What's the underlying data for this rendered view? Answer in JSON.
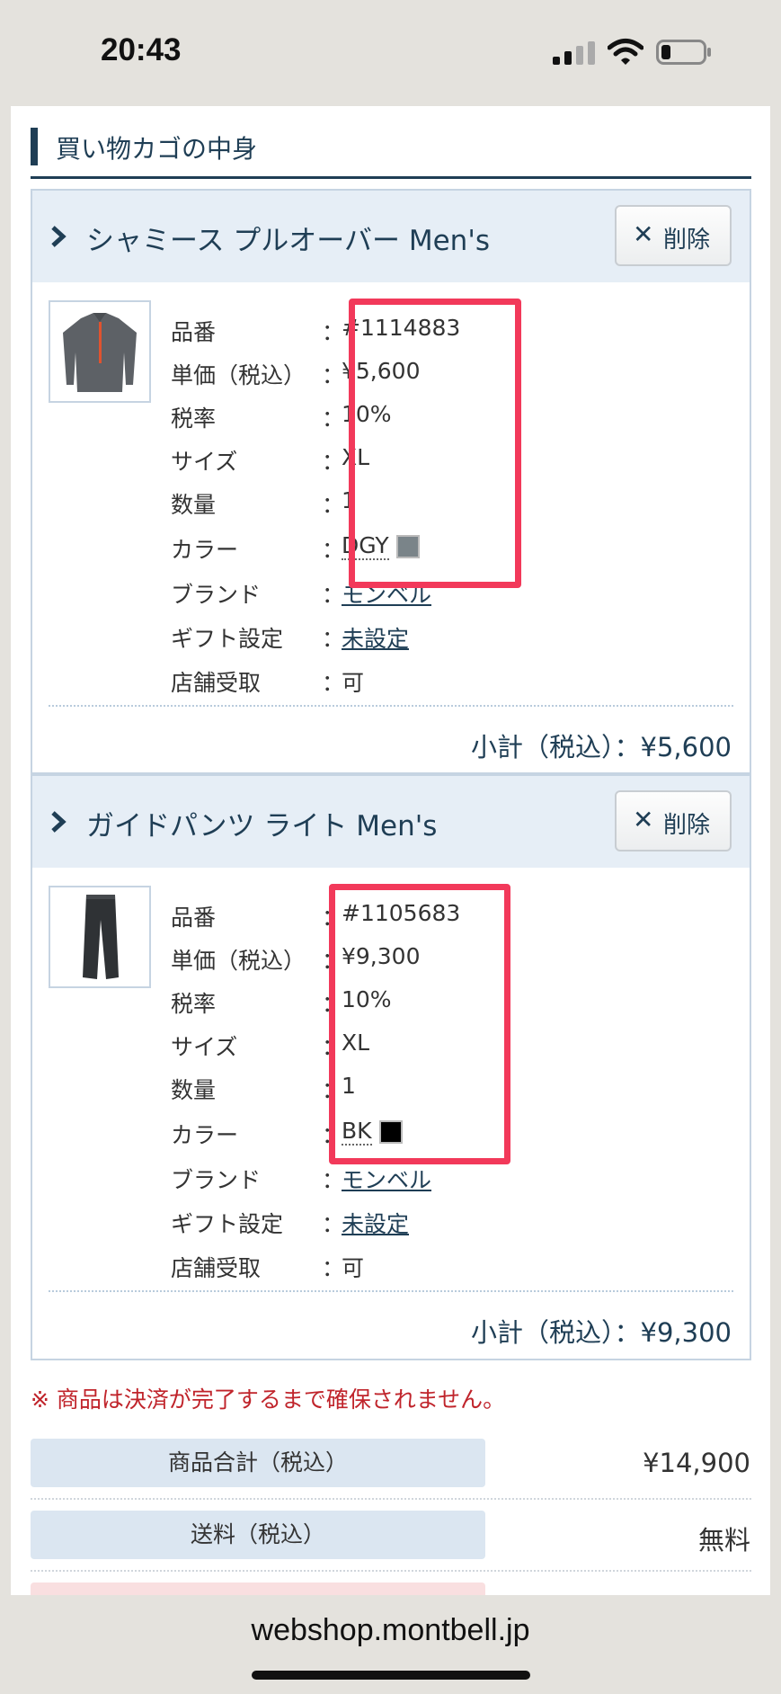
{
  "status_bar": {
    "time": "20:43"
  },
  "section_title": "買い物カゴの中身",
  "labels": {
    "colon": "：",
    "delete": "削除"
  },
  "items": [
    {
      "name": "シャミース プルオーバー Men's",
      "thumbnail": "pullover-jacket-image",
      "fields": {
        "part_no": {
          "label": "品番",
          "value": "#1114883"
        },
        "unit_price": {
          "label": "単価（税込）",
          "value": "¥5,600"
        },
        "tax_rate": {
          "label": "税率",
          "value": "10%"
        },
        "size": {
          "label": "サイズ",
          "value": "XL"
        },
        "quantity": {
          "label": "数量",
          "value": "1"
        },
        "color": {
          "label": "カラー",
          "value": "DGY",
          "swatch": "#7a8489"
        },
        "brand": {
          "label": "ブランド",
          "value": "モンベル"
        },
        "gift": {
          "label": "ギフト設定",
          "value": "未設定"
        },
        "store_pickup": {
          "label": "店舗受取",
          "value": "可"
        }
      },
      "subtotal": "小計（税込）：¥5,600"
    },
    {
      "name": "ガイドパンツ ライト Men's",
      "thumbnail": "pants-image",
      "fields": {
        "part_no": {
          "label": "品番",
          "value": "#1105683"
        },
        "unit_price": {
          "label": "単価（税込）",
          "value": "¥9,300"
        },
        "tax_rate": {
          "label": "税率",
          "value": "10%"
        },
        "size": {
          "label": "サイズ",
          "value": "XL"
        },
        "quantity": {
          "label": "数量",
          "value": "1"
        },
        "color": {
          "label": "カラー",
          "value": "BK",
          "swatch": "#000000"
        },
        "brand": {
          "label": "ブランド",
          "value": "モンベル"
        },
        "gift": {
          "label": "ギフト設定",
          "value": "未設定"
        },
        "store_pickup": {
          "label": "店舗受取",
          "value": "可"
        }
      },
      "subtotal": "小計（税込）：¥9,300"
    }
  ],
  "notice": "※ 商品は決済が完了するまで確保されません。",
  "totals": {
    "goods": {
      "label": "商品合計（税込）",
      "value": "¥14,900"
    },
    "shipping": {
      "label": "送料（税込）",
      "value": "無料"
    }
  },
  "browser": {
    "url": "webshop.montbell.jp"
  },
  "colors": {
    "accent": "#1f3e55",
    "highlight": "#f2395a",
    "notice": "#c0242b",
    "header_bg": "#e6eef6"
  }
}
